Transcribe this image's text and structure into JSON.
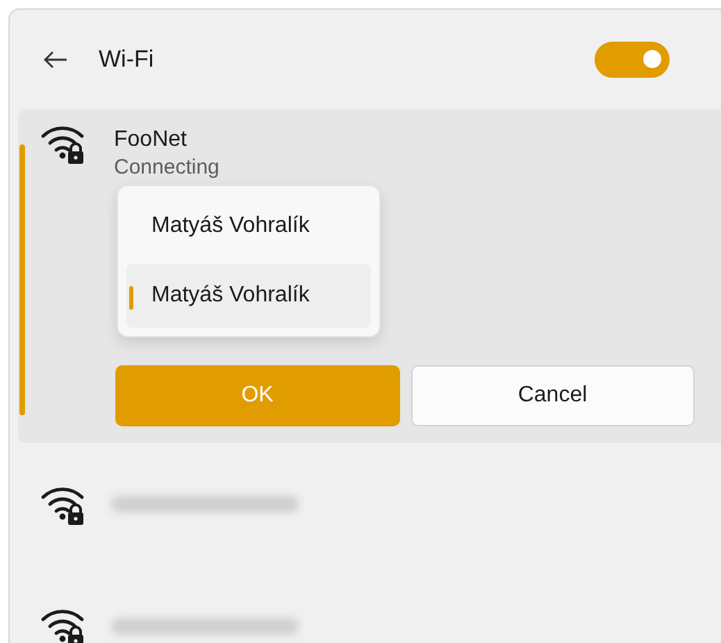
{
  "header": {
    "title": "Wi-Fi",
    "toggle": {
      "on": true
    }
  },
  "networks": [
    {
      "name": "FooNet",
      "status": "Connecting",
      "expanded": true,
      "accounts": [
        {
          "label": "Matyáš Vohralík",
          "selected": false
        },
        {
          "label": "Matyáš Vohralík",
          "selected": true
        }
      ],
      "buttons": [
        {
          "label": "OK",
          "kind": "primary"
        },
        {
          "label": "Cancel",
          "kind": "secondary"
        }
      ]
    },
    {
      "expanded": false
    },
    {
      "expanded": false
    }
  ]
}
